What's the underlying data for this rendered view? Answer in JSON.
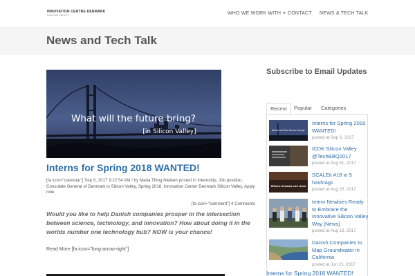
{
  "header": {
    "logo_line1": "INNOVATION CENTRE DENMARK",
    "logo_line2": "SILICON VALLEY",
    "nav": [
      {
        "label": "WHO WE WORK WITH",
        "has_dropdown": true
      },
      {
        "label": "CONTACT"
      },
      {
        "label": "NEWS & TECH TALK"
      }
    ]
  },
  "page": {
    "title": "News and Tech Talk"
  },
  "post": {
    "image_text_line1": "What will the future bring?",
    "image_text_line2": "[in Silicon Valley]",
    "title": "Interns for Spring 2018 WANTED!",
    "meta_date": "[fa icon=\"calendar\"] Sep 6, 2017 9:22:54 AM",
    "meta_by": " / by ",
    "meta_author": "Maria Thing Nielsen",
    "meta_posted_in": " posted in ",
    "meta_tags": "Internship, Job position, Consulate General of Denmark in Silicon Valley, Spring 2018, Innovation Center Denmark Silicon Valley, Apply now",
    "comments": "[fa icon=\"comment\"] 4 Comments",
    "excerpt": "Would you like to help Danish companies prosper in the intersection between science, technology, and innovation? How about doing it in the worlds number one technology hub? NOW is your chance!",
    "read_more": "Read More [fa icon=\"long-arrow-right\"]"
  },
  "sidebar": {
    "subscribe_title": "Subscribe to Email Updates",
    "tabs": [
      {
        "label": "Recent",
        "active": true
      },
      {
        "label": "Popular",
        "active": false
      },
      {
        "label": "Categories",
        "active": false
      }
    ],
    "items": [
      {
        "title": "Interns for Spring 2018 WANTED!",
        "date": "posted at Sep 6, 2017",
        "thumb_text": "What will the future bring?"
      },
      {
        "title": "ICDK Silicon Valley @TechBBQ2017",
        "date": "posted at Aug 31, 2017",
        "thumb_text": ""
      },
      {
        "title": "SCALEit #18 in 5 hashtags",
        "date": "posted at Aug 25, 2017",
        "thumb_text": "Where dreams are born"
      },
      {
        "title": "Intern Newbies Ready to Embrace the Innovative Silicon Valley Way [News]",
        "date": "posted at Aug 13, 2017",
        "thumb_text": ""
      },
      {
        "title": "Danish Companies to Map Groundwater in California",
        "date": "posted at Jun 21, 2017",
        "thumb_text": ""
      }
    ],
    "last_link": "Interns for Spring 2018 WANTED!"
  },
  "colors": {
    "link": "#2e6ea6",
    "title_band": "#f5f5f5",
    "text": "#555555"
  }
}
